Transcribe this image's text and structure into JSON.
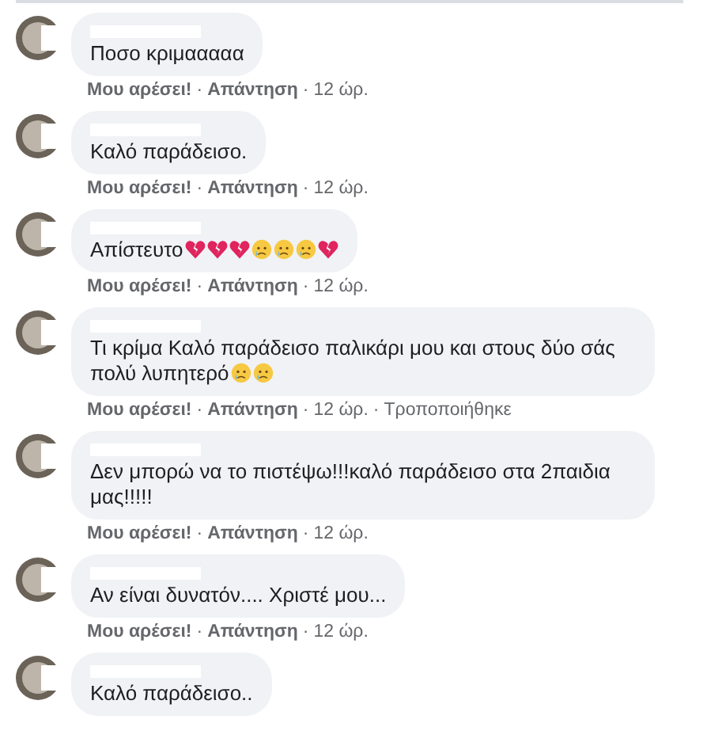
{
  "comments": [
    {
      "text": "Ποσο κριμααααα",
      "actions": {
        "like": "Μου αρέσει!",
        "reply": "Απάντηση",
        "time": "12 ώρ.",
        "separator": "·"
      }
    },
    {
      "text": "Καλό παράδεισο.",
      "actions": {
        "like": "Μου αρέσει!",
        "reply": "Απάντηση",
        "time": "12 ώρ.",
        "separator": "·"
      }
    },
    {
      "text": "Απίστευτο",
      "emojis": [
        {
          "kind": "broken-heart"
        },
        {
          "kind": "broken-heart"
        },
        {
          "kind": "broken-heart"
        },
        {
          "kind": "crying"
        },
        {
          "kind": "crying"
        },
        {
          "kind": "crying"
        },
        {
          "kind": "broken-heart"
        }
      ],
      "actions": {
        "like": "Μου αρέσει!",
        "reply": "Απάντηση",
        "time": "12 ώρ.",
        "separator": "·"
      }
    },
    {
      "text": "Τι κρίμα Καλό παράδεισο παλικάρι μου και στους δύο σάς πολύ λυπητερό",
      "emojis": [
        {
          "kind": "crying"
        },
        {
          "kind": "crying"
        }
      ],
      "actions": {
        "like": "Μου αρέσει!",
        "reply": "Απάντηση",
        "time": "12 ώρ.",
        "edited": "Τροποποιήθηκε",
        "separator": "·"
      }
    },
    {
      "text": "Δεν μπορώ να το πιστέψω!!!καλό παράδεισο στα 2παιδια μας!!!!!",
      "actions": {
        "like": "Μου αρέσει!",
        "reply": "Απάντηση",
        "time": "12 ώρ.",
        "separator": "·"
      }
    },
    {
      "text": "Αν είναι δυνατόν.... Χριστέ μου...",
      "actions": {
        "like": "Μου αρέσει!",
        "reply": "Απάντηση",
        "time": "12 ώρ.",
        "separator": "·"
      }
    },
    {
      "text": "Καλό παράδεισο.."
    }
  ]
}
